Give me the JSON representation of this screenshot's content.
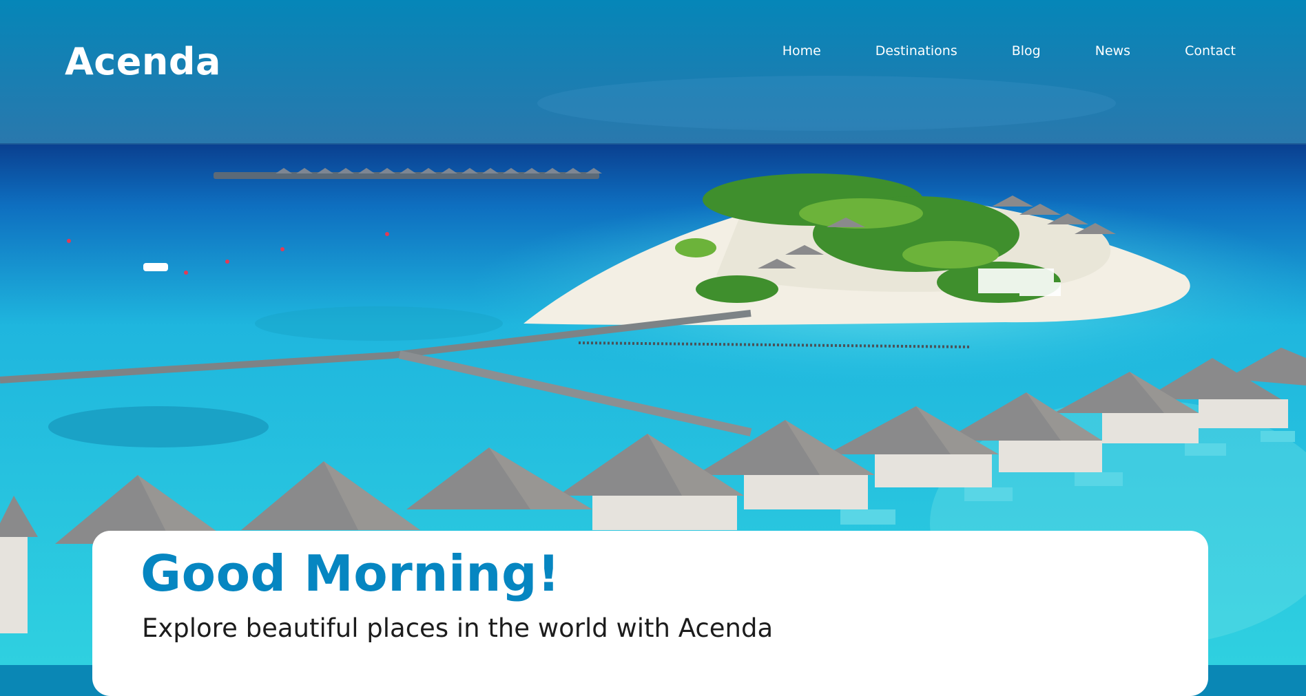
{
  "brand": {
    "name": "Acenda"
  },
  "nav": {
    "items": [
      "Home",
      "Destinations",
      "Blog",
      "News",
      "Contact"
    ]
  },
  "hero": {
    "greeting": "Good Morning!",
    "tagline": "Explore beautiful places in the world with Acenda",
    "image": "tropical-island-resort-with-overwater-bungalows"
  },
  "colors": {
    "accent": "#0686c1",
    "sky": "#0a85b5",
    "ocean_deep": "#0a4f9e",
    "lagoon": "#2bc4df",
    "card_bg": "#ffffff",
    "text_dark": "#1c1c1c"
  }
}
